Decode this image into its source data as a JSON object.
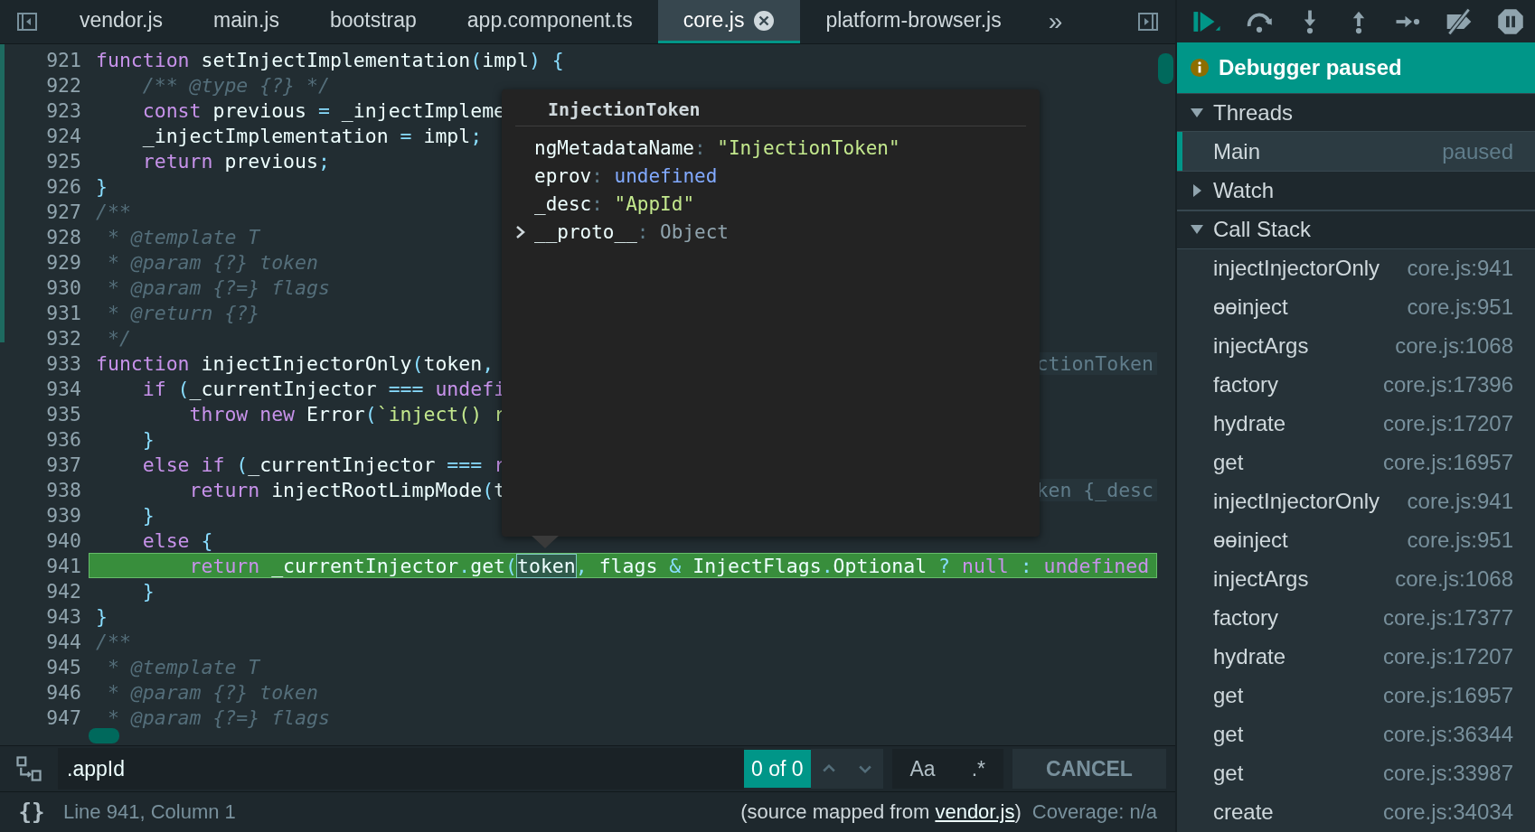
{
  "tabs": [
    {
      "label": "vendor.js",
      "selected": false
    },
    {
      "label": "main.js",
      "selected": false
    },
    {
      "label": "bootstrap",
      "selected": false
    },
    {
      "label": "app.component.ts",
      "selected": false
    },
    {
      "label": "core.js",
      "selected": true
    },
    {
      "label": "platform-browser.js",
      "selected": false
    }
  ],
  "more_tabs": "»",
  "code_lines": [
    {
      "number": "921",
      "highlighted": false,
      "tokens": [
        {
          "kind": "kw",
          "text": "function"
        },
        {
          "kind": "plain",
          "text": " setInjectImplementation"
        },
        {
          "kind": "punct",
          "text": "("
        },
        {
          "kind": "plain",
          "text": "impl"
        },
        {
          "kind": "punct",
          "text": ") {"
        }
      ]
    },
    {
      "number": "922",
      "highlighted": false,
      "tokens": [
        {
          "kind": "comment",
          "text": "    /** @type {?} */"
        }
      ]
    },
    {
      "number": "923",
      "highlighted": false,
      "tokens": [
        {
          "kind": "kw",
          "text": "    const"
        },
        {
          "kind": "plain",
          "text": " previous "
        },
        {
          "kind": "punct",
          "text": "="
        },
        {
          "kind": "plain",
          "text": " _injectImpleme"
        }
      ]
    },
    {
      "number": "924",
      "highlighted": false,
      "tokens": [
        {
          "kind": "plain",
          "text": "    _injectImplementation "
        },
        {
          "kind": "punct",
          "text": "="
        },
        {
          "kind": "plain",
          "text": " impl"
        },
        {
          "kind": "punct",
          "text": ";"
        }
      ]
    },
    {
      "number": "925",
      "highlighted": false,
      "tokens": [
        {
          "kind": "kw",
          "text": "    return"
        },
        {
          "kind": "plain",
          "text": " previous"
        },
        {
          "kind": "punct",
          "text": ";"
        }
      ]
    },
    {
      "number": "926",
      "highlighted": false,
      "tokens": [
        {
          "kind": "punct",
          "text": "}"
        }
      ]
    },
    {
      "number": "927",
      "highlighted": false,
      "tokens": [
        {
          "kind": "comment",
          "text": "/**"
        }
      ]
    },
    {
      "number": "928",
      "highlighted": false,
      "tokens": [
        {
          "kind": "comment",
          "text": " * @template T"
        }
      ]
    },
    {
      "number": "929",
      "highlighted": false,
      "tokens": [
        {
          "kind": "comment",
          "text": " * @param {?} token"
        }
      ]
    },
    {
      "number": "930",
      "highlighted": false,
      "tokens": [
        {
          "kind": "comment",
          "text": " * @param {?=} flags"
        }
      ]
    },
    {
      "number": "931",
      "highlighted": false,
      "tokens": [
        {
          "kind": "comment",
          "text": " * @return {?}"
        }
      ]
    },
    {
      "number": "932",
      "highlighted": false,
      "tokens": [
        {
          "kind": "comment",
          "text": " */"
        }
      ]
    },
    {
      "number": "933",
      "highlighted": false,
      "tokens": [
        {
          "kind": "kw",
          "text": "function"
        },
        {
          "kind": "plain",
          "text": " injectInjectorOnly"
        },
        {
          "kind": "punct",
          "text": "("
        },
        {
          "kind": "plain",
          "text": "token"
        },
        {
          "kind": "punct",
          "text": ","
        }
      ],
      "hint": "ctionToken"
    },
    {
      "number": "934",
      "highlighted": false,
      "tokens": [
        {
          "kind": "kw",
          "text": "    if"
        },
        {
          "kind": "punct",
          "text": " ("
        },
        {
          "kind": "plain",
          "text": "_currentInjector "
        },
        {
          "kind": "punct",
          "text": "==="
        },
        {
          "kind": "kw",
          "text": " undefi"
        }
      ]
    },
    {
      "number": "935",
      "highlighted": false,
      "tokens": [
        {
          "kind": "kw",
          "text": "        throw new"
        },
        {
          "kind": "plain",
          "text": " Error"
        },
        {
          "kind": "punct",
          "text": "("
        },
        {
          "kind": "str",
          "text": "`inject() r"
        }
      ]
    },
    {
      "number": "936",
      "highlighted": false,
      "tokens": [
        {
          "kind": "punct",
          "text": "    }"
        }
      ]
    },
    {
      "number": "937",
      "highlighted": false,
      "tokens": [
        {
          "kind": "kw",
          "text": "    else if"
        },
        {
          "kind": "punct",
          "text": " ("
        },
        {
          "kind": "plain",
          "text": "_currentInjector "
        },
        {
          "kind": "punct",
          "text": "==="
        },
        {
          "kind": "kw",
          "text": " r"
        }
      ]
    },
    {
      "number": "938",
      "highlighted": false,
      "tokens": [
        {
          "kind": "kw",
          "text": "        return"
        },
        {
          "kind": "plain",
          "text": " injectRootLimpMode"
        },
        {
          "kind": "punct",
          "text": "("
        },
        {
          "kind": "plain",
          "text": "t"
        }
      ],
      "hint": "ken {_desc"
    },
    {
      "number": "939",
      "highlighted": false,
      "tokens": [
        {
          "kind": "punct",
          "text": "    }"
        }
      ]
    },
    {
      "number": "940",
      "highlighted": false,
      "tokens": [
        {
          "kind": "kw",
          "text": "    else"
        },
        {
          "kind": "punct",
          "text": " {"
        }
      ]
    },
    {
      "number": "941",
      "highlighted": true,
      "tokens": [
        {
          "kind": "kw",
          "text": "        return"
        },
        {
          "kind": "plain",
          "text": " _currentInjector"
        },
        {
          "kind": "punct",
          "text": "."
        },
        {
          "kind": "plain",
          "text": "get"
        },
        {
          "kind": "punct",
          "text": "("
        },
        {
          "kind": "hovered",
          "text": "token"
        },
        {
          "kind": "punct",
          "text": ","
        },
        {
          "kind": "plain",
          "text": " flags "
        },
        {
          "kind": "punct",
          "text": "&"
        },
        {
          "kind": "plain",
          "text": " InjectFlags"
        },
        {
          "kind": "punct",
          "text": "."
        },
        {
          "kind": "plain",
          "text": "Optional "
        },
        {
          "kind": "punct",
          "text": "?"
        },
        {
          "kind": "kw",
          "text": " null"
        },
        {
          "kind": "punct",
          "text": " :"
        },
        {
          "kind": "kw",
          "text": " undefined"
        }
      ]
    },
    {
      "number": "942",
      "highlighted": false,
      "tokens": [
        {
          "kind": "punct",
          "text": "    }"
        }
      ]
    },
    {
      "number": "943",
      "highlighted": false,
      "tokens": [
        {
          "kind": "punct",
          "text": "}"
        }
      ]
    },
    {
      "number": "944",
      "highlighted": false,
      "tokens": [
        {
          "kind": "comment",
          "text": "/**"
        }
      ]
    },
    {
      "number": "945",
      "highlighted": false,
      "tokens": [
        {
          "kind": "comment",
          "text": " * @template T"
        }
      ]
    },
    {
      "number": "946",
      "highlighted": false,
      "tokens": [
        {
          "kind": "comment",
          "text": " * @param {?} token"
        }
      ]
    },
    {
      "number": "947",
      "highlighted": false,
      "tokens": [
        {
          "kind": "comment",
          "text": " * @param {?=} flags"
        }
      ]
    }
  ],
  "tooltip": {
    "title": "InjectionToken",
    "properties": [
      {
        "name": "ngMetadataName",
        "sep": ":",
        "value": "\"InjectionToken\"",
        "kind": "string",
        "expandable": false
      },
      {
        "name": "eprov",
        "sep": ":",
        "value": "undefined",
        "kind": "keyword",
        "expandable": false
      },
      {
        "name": "_desc",
        "sep": ":",
        "value": "\"AppId\"",
        "kind": "string",
        "expandable": false
      },
      {
        "name": "__proto__",
        "sep": ":",
        "value": "Object",
        "kind": "object",
        "expandable": true
      }
    ]
  },
  "search": {
    "value": ".appId",
    "count": "0 of 0",
    "case_label": "Aa",
    "regex_label": ".*",
    "cancel": "CANCEL"
  },
  "status_bar": {
    "format_label": "{}",
    "position": "Line 941, Column 1",
    "source_prefix": "(source mapped from ",
    "source_link": "vendor.js",
    "source_suffix": ")",
    "coverage": "Coverage: n/a"
  },
  "debugger": {
    "banner": "Debugger paused",
    "sections": [
      {
        "kind": "threads",
        "title": "Threads",
        "expanded": true,
        "threads": [
          {
            "name": "Main",
            "status": "paused",
            "selected": true
          }
        ]
      },
      {
        "kind": "watch",
        "title": "Watch",
        "expanded": false
      },
      {
        "kind": "callstack",
        "title": "Call Stack",
        "expanded": true,
        "frames": [
          {
            "name": "injectInjectorOnly",
            "location": "core.js:941"
          },
          {
            "name": "ɵɵinject",
            "location": "core.js:951"
          },
          {
            "name": "injectArgs",
            "location": "core.js:1068"
          },
          {
            "name": "factory",
            "location": "core.js:17396"
          },
          {
            "name": "hydrate",
            "location": "core.js:17207"
          },
          {
            "name": "get",
            "location": "core.js:16957"
          },
          {
            "name": "injectInjectorOnly",
            "location": "core.js:941"
          },
          {
            "name": "ɵɵinject",
            "location": "core.js:951"
          },
          {
            "name": "injectArgs",
            "location": "core.js:1068"
          },
          {
            "name": "factory",
            "location": "core.js:17377"
          },
          {
            "name": "hydrate",
            "location": "core.js:17207"
          },
          {
            "name": "get",
            "location": "core.js:16957"
          },
          {
            "name": "get",
            "location": "core.js:36344"
          },
          {
            "name": "get",
            "location": "core.js:33987"
          },
          {
            "name": "create",
            "location": "core.js:34034"
          }
        ]
      }
    ]
  }
}
